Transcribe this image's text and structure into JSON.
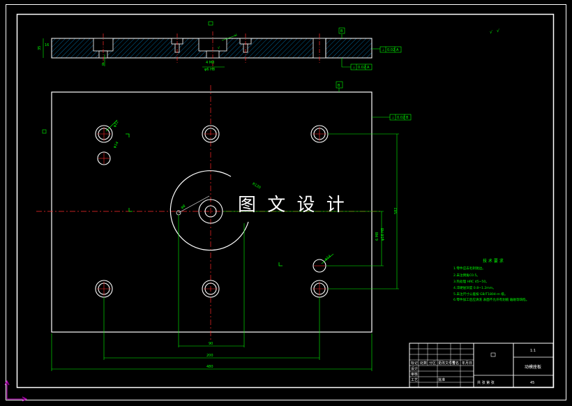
{
  "watermark": "图 文 设 计",
  "roughness_symbol": "√",
  "colors": {
    "background": "#000000",
    "outline": "#ffffff",
    "centerline": "#ff2a2a",
    "dimension": "#00ff00",
    "hatch": "#00aaff",
    "ucs": "#cc00cc"
  },
  "dimensions": {
    "height_total": "582",
    "hole_pitch": "200",
    "overall_width": "480",
    "vertical_pitch": "90",
    "side_a": "6 M8",
    "side_b": "φ16 H8",
    "top_a": "4 M8",
    "top_b": "φ6 H8",
    "hole_small": "φ14",
    "hole_dia": "φ22",
    "slot": "φ8",
    "bottom_small": "8",
    "thickness": "35",
    "side_label": "16",
    "arc_label": "R120"
  },
  "tolerance_frames": {
    "top_datum": "B",
    "top_right": [
      "⊥",
      "0.02",
      "A"
    ],
    "side_bottom": [
      "⊥",
      "0.02",
      "A"
    ],
    "plan_datum": "B",
    "plan_right": [
      "⊥",
      "0.02",
      "B"
    ]
  },
  "tech_req": {
    "title": "技 术 要 求",
    "lines": [
      "1.零件应去毛刺锐边。",
      "2.未注倒角C0.5。",
      "3.热处理 HRC 45~50。",
      "4.淬硬层深度 0.8~1.2mm。",
      "5.未注尺寸公差按 GB/T1804-m 级。",
      "6.零件加工后应清洗 表面不允许有划痕 磕碰等缺陷。"
    ]
  },
  "title_block": {
    "part_name": "动模座板",
    "scale": "1:1",
    "material": "45",
    "labels": [
      "标记",
      "处数",
      "分区",
      "更改文件号",
      "签名",
      "年月日",
      "设计",
      "审核",
      "工艺",
      "批准"
    ],
    "bottom": "共 张 第 张"
  }
}
